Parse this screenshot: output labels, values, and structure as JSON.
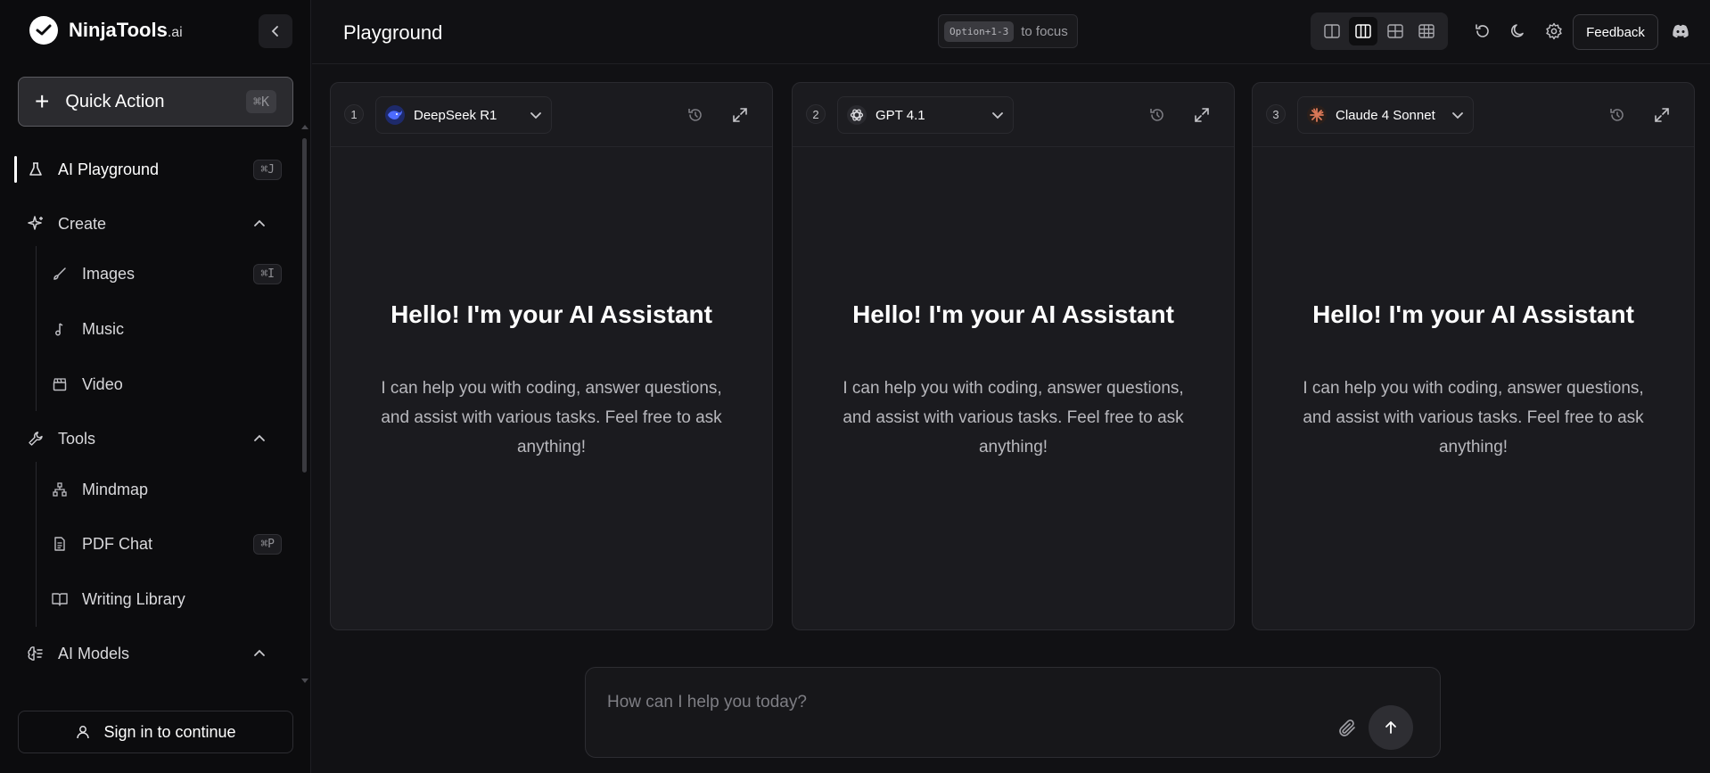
{
  "app": {
    "brand_name": "NinjaTools",
    "brand_suffix": ".ai"
  },
  "sidebar": {
    "quick_action": {
      "label": "Quick Action",
      "shortcut": "⌘K"
    },
    "items": [
      {
        "label": "AI Playground",
        "shortcut": "⌘J",
        "icon": "flask-icon",
        "active": true
      },
      {
        "label": "Create",
        "icon": "sparkles-icon",
        "section": true,
        "expanded": true
      },
      {
        "label": "Images",
        "shortcut": "⌘I",
        "icon": "brush-icon"
      },
      {
        "label": "Music",
        "icon": "music-note-icon"
      },
      {
        "label": "Video",
        "icon": "clapperboard-icon"
      },
      {
        "label": "Tools",
        "icon": "wrench-icon",
        "section": true,
        "expanded": true
      },
      {
        "label": "Mindmap",
        "icon": "network-icon"
      },
      {
        "label": "PDF Chat",
        "shortcut": "⌘P",
        "icon": "file-text-icon"
      },
      {
        "label": "Writing Library",
        "icon": "book-open-icon"
      },
      {
        "label": "AI Models",
        "icon": "brain-icon",
        "section": true,
        "expanded": true
      }
    ],
    "sign_in_label": "Sign in to continue"
  },
  "header": {
    "title": "Playground",
    "focus_hint_key": "Option+1-3",
    "focus_hint_text": "to focus",
    "layout_options": [
      "two-columns",
      "three-columns",
      "grid-2x2",
      "grid-3x3"
    ],
    "selected_layout": "three-columns",
    "feedback_label": "Feedback"
  },
  "panels": [
    {
      "number": "1",
      "model": "DeepSeek R1",
      "greeting_title": "Hello! I'm your AI Assistant",
      "greeting_text": "I can help you with coding, answer questions, and assist with various tasks. Feel free to ask anything!"
    },
    {
      "number": "2",
      "model": "GPT 4.1",
      "greeting_title": "Hello! I'm your AI Assistant",
      "greeting_text": "I can help you with coding, answer questions, and assist with various tasks. Feel free to ask anything!"
    },
    {
      "number": "3",
      "model": "Claude 4 Sonnet",
      "greeting_title": "Hello! I'm your AI Assistant",
      "greeting_text": "I can help you with coding, answer questions, and assist with various tasks. Feel free to ask anything!"
    }
  ],
  "composer": {
    "placeholder": "How can I help you today?"
  },
  "colors": {
    "background": "#111114",
    "sidebar": "#0c0c0e",
    "panel": "#1b1b1f",
    "deepseek_blue": "#4d6bfe",
    "claude_orange": "#d97757"
  }
}
